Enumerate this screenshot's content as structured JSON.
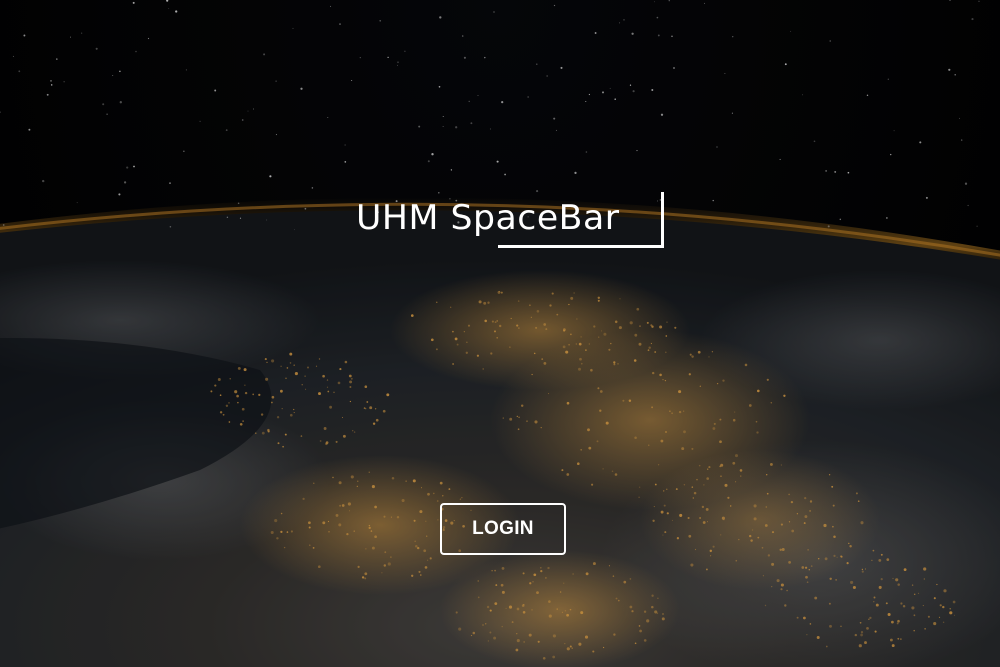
{
  "logo": {
    "text": "UHM SpaceBar"
  },
  "login_button": {
    "label": "LOGIN"
  },
  "colors": {
    "text": "#ffffff",
    "atmosphere": "#c98a2e",
    "space": "#030304",
    "city_lights": "#e8a84a"
  }
}
